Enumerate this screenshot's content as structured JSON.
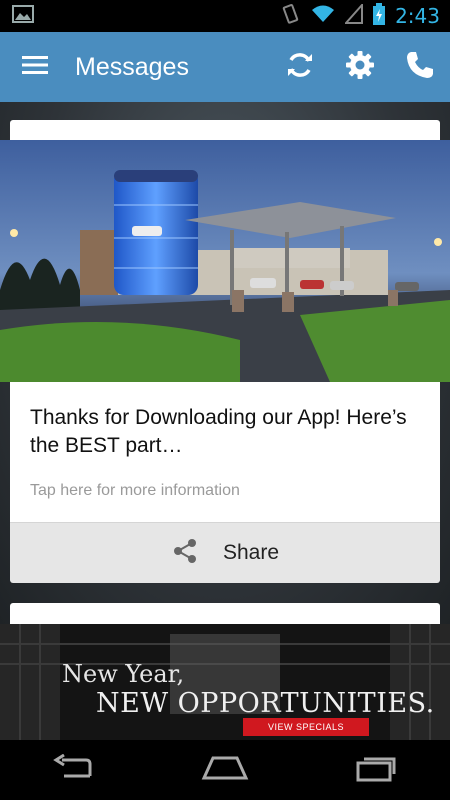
{
  "status_bar": {
    "time": "2:43",
    "icons": [
      "image-icon",
      "vibrate-icon",
      "wifi-icon",
      "signal-icon",
      "battery-charging-icon"
    ]
  },
  "action_bar": {
    "title": "Messages",
    "icons": [
      "menu-icon",
      "refresh-icon",
      "settings-gear-icon",
      "phone-icon"
    ],
    "color": "#4a8dbf"
  },
  "message_card": {
    "title": "Thanks for Downloading our App! Here’s the BEST part…",
    "subtitle": "Tap here for more information",
    "share_label": "Share",
    "image": "dealership-photo"
  },
  "banner": {
    "line1": "New Year,",
    "line2": "NEW OPPORTUNITIES.",
    "button_label": "VIEW SPECIALS",
    "button_color": "#d0181f"
  },
  "nav_bar": {
    "icons": [
      "back-icon",
      "home-icon",
      "recents-icon"
    ]
  }
}
